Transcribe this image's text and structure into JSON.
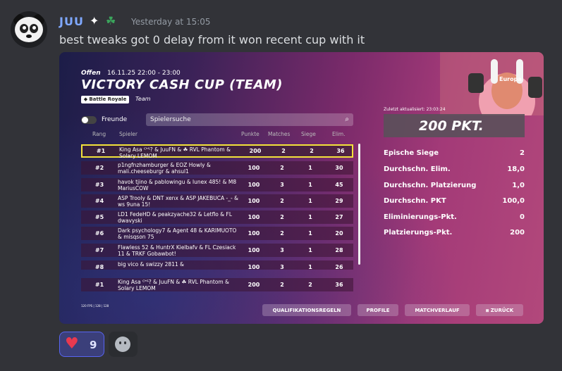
{
  "message": {
    "username": "JUU",
    "sparkle_icon": "✦",
    "clover_icon": "☘",
    "timestamp": "Yesterday at 15:05",
    "text": "best tweaks got 0 delay from it won recent cup with it"
  },
  "game": {
    "status": "Offen",
    "datetime": "16.11.25 22:00 - 23:00",
    "title": "VICTORY CASH CUP (TEAM)",
    "mode": "Battle Royale",
    "mode_type": "Team",
    "friends_label": "Freunde",
    "search_placeholder": "Spielersuche",
    "columns": {
      "rank": "Rang",
      "player": "Spieler",
      "points": "Punkte",
      "matches": "Matches",
      "wins": "Siege",
      "elims": "Elim."
    },
    "rows": [
      {
        "rank": "#1",
        "names": "King Asa ᑦᑋᕐ? & JuuFN & ☘ RVL Phantom & Solary LEMOM",
        "points": "200",
        "matches": "2",
        "wins": "2",
        "elims": "36"
      },
      {
        "rank": "#2",
        "names": "p1ngfnzhamburger & EOZ Howly & mali.cheeseburgr & ahsul1",
        "points": "100",
        "matches": "2",
        "wins": "1",
        "elims": "30"
      },
      {
        "rank": "#3",
        "names": "havok tjino & pablowingu & lunex 485! & M8 MariusCOW",
        "points": "100",
        "matches": "3",
        "wins": "1",
        "elims": "45"
      },
      {
        "rank": "#4",
        "names": "ASP Trooly & DNT xenx & ASP JAKEBUCA -_- & ws 9una 15!",
        "points": "100",
        "matches": "2",
        "wins": "1",
        "elims": "29"
      },
      {
        "rank": "#5",
        "names": "LD1 FedeHD & peakzyache32 & Letflo & FL dwavyski",
        "points": "100",
        "matches": "2",
        "wins": "1",
        "elims": "27"
      },
      {
        "rank": "#6",
        "names": "Dark psychology7 & Agent 48 & KARIMUOTO & misqson 75",
        "points": "100",
        "matches": "2",
        "wins": "1",
        "elims": "20"
      },
      {
        "rank": "#7",
        "names": "Flawless 52 & HuntrX Kielbafv & FL Czesiack 11 & TRKF Gobawbot!",
        "points": "100",
        "matches": "3",
        "wins": "1",
        "elims": "28"
      },
      {
        "rank": "#8",
        "names": "big vico & swizzy 2811 &",
        "points": "100",
        "matches": "3",
        "wins": "1",
        "elims": "26"
      }
    ],
    "pinned_row": {
      "rank": "#1",
      "names": "King Asa ᑦᑋᕐ? & JuuFN & ☘ RVL Phantom & Solary LEMOM",
      "points": "200",
      "matches": "2",
      "wins": "2",
      "elims": "36"
    },
    "updated": "Zuletzt aktualisiert: 23:03:24",
    "points_display": "200 PKT.",
    "region": "Europa",
    "stats": [
      {
        "label": "Epische Siege",
        "value": "2"
      },
      {
        "label": "Durchschn. Elim.",
        "value": "18,0"
      },
      {
        "label": "Durchschn. Platzierung",
        "value": "1,0"
      },
      {
        "label": "Durchschn. PKT",
        "value": "100,0"
      },
      {
        "label": "Eliminierungs-Pkt.",
        "value": "0"
      },
      {
        "label": "Platzierungs-Pkt.",
        "value": "200"
      }
    ],
    "buttons": {
      "rules": "QUALIFIKATIONSREGELN",
      "profile": "PROFILE",
      "history": "MATCHVERLAUF",
      "back": "ZURÜCK"
    },
    "fps": "120 FPS | 128 | 128"
  },
  "reaction": {
    "emoji": "♥",
    "count": "9"
  },
  "colors": {
    "highlight": "#f3e23a",
    "username": "#7fa8ff",
    "reaction_border": "#5865f2"
  }
}
